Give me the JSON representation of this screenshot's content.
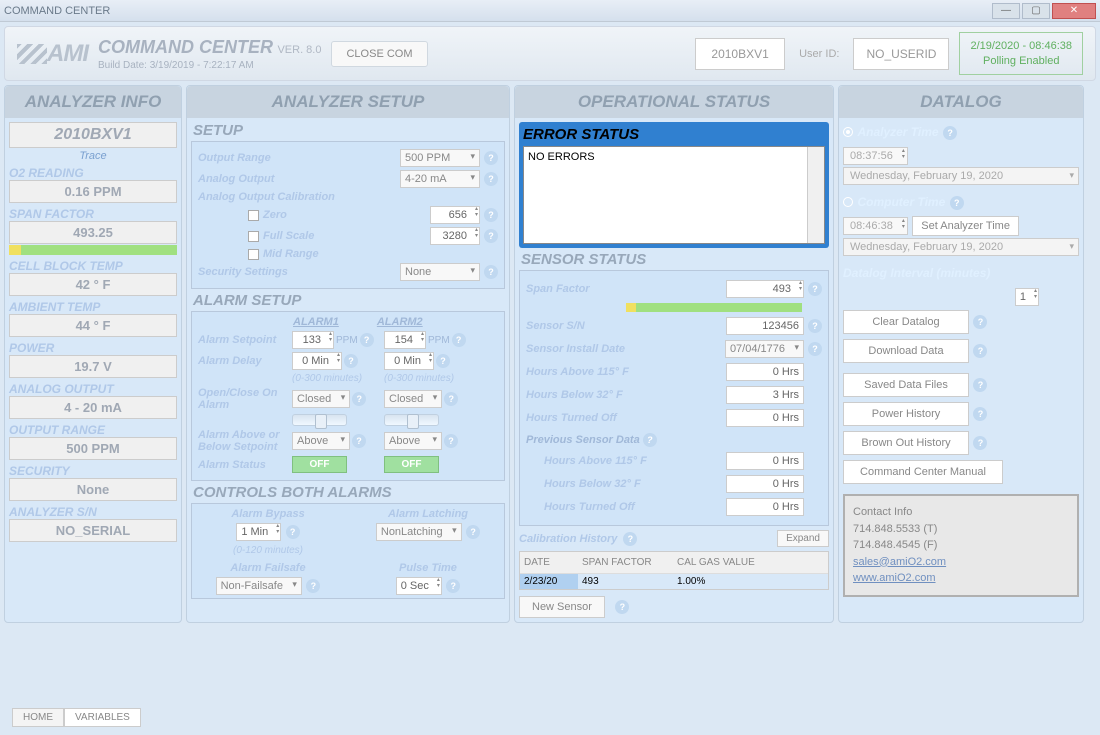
{
  "titlebar": {
    "title": "COMMAND CENTER"
  },
  "header": {
    "app_title": "COMMAND CENTER",
    "version": "VER. 8.0",
    "build_date": "Build Date:  3/19/2019 - 7:22:17 AM",
    "close_com": "CLOSE COM",
    "analyzer_id": "2010BXV1",
    "user_id_label": "User ID:",
    "user_id": "NO_USERID",
    "poll_time": "2/19/2020 - 08:46:38",
    "poll_status": "Polling Enabled"
  },
  "tabs": {
    "analyzer_info": "ANALYZER INFO",
    "analyzer_setup": "ANALYZER SETUP",
    "operational_status": "OPERATIONAL STATUS",
    "datalog": "DATALOG"
  },
  "info": {
    "name": "2010BXV1",
    "sub": "Trace",
    "o2_label": "O2 READING",
    "o2_val": "0.16 PPM",
    "span_label": "SPAN FACTOR",
    "span_val": "493.25",
    "cell_label": "CELL BLOCK TEMP",
    "cell_val": "42 ° F",
    "amb_label": "AMBIENT TEMP",
    "amb_val": "44 ° F",
    "power_label": "POWER",
    "power_val": "19.7 V",
    "analog_label": "ANALOG OUTPUT",
    "analog_val": "4 - 20 mA",
    "range_label": "OUTPUT RANGE",
    "range_val": "500 PPM",
    "sec_label": "SECURITY",
    "sec_val": "None",
    "sn_label": "ANALYZER S/N",
    "sn_val": "NO_SERIAL"
  },
  "setup": {
    "title": "SETUP",
    "output_range_label": "Output Range",
    "output_range": "500 PPM",
    "analog_output_label": "Analog Output",
    "analog_output": "4-20 mA",
    "calib_label": "Analog Output Calibration",
    "zero_label": "Zero",
    "zero_val": "656",
    "full_label": "Full Scale",
    "full_val": "3280",
    "mid_label": "Mid Range",
    "sec_label": "Security Settings",
    "sec_val": "None"
  },
  "alarm": {
    "title": "ALARM SETUP",
    "h1": "ALARM1",
    "h2": "ALARM2",
    "setpoint_label": "Alarm Setpoint",
    "sp1": "133",
    "sp2": "154",
    "ppm": "PPM",
    "delay_label": "Alarm Delay",
    "d1": "0 Min",
    "d2": "0 Min",
    "delay_note": "(0-300 minutes)",
    "oc_label": "Open/Close On Alarm",
    "oc1": "Closed",
    "oc2": "Closed",
    "ab_label": "Alarm Above or Below Setpoint",
    "ab1": "Above",
    "ab2": "Above",
    "status_label": "Alarm Status",
    "off": "OFF"
  },
  "controls": {
    "title": "CONTROLS BOTH ALARMS",
    "bypass_label": "Alarm Bypass",
    "bypass_val": "1 Min",
    "bypass_note": "(0-120 minutes)",
    "latch_label": "Alarm Latching",
    "latch_val": "NonLatching",
    "fail_label": "Alarm Failsafe",
    "fail_val": "Non-Failsafe",
    "pulse_label": "Pulse Time",
    "pulse_val": "0 Sec"
  },
  "op": {
    "error_title": "ERROR STATUS",
    "error_text": "NO ERRORS",
    "sensor_title": "SENSOR STATUS",
    "span_label": "Span Factor",
    "span_val": "493",
    "sn_label": "Sensor S/N",
    "sn_val": "123456",
    "inst_label": "Sensor Install Date",
    "inst_val": "07/04/1776",
    "h115_label": "Hours Above 115° F",
    "h115_val": "0 Hrs",
    "h32_label": "Hours Below 32° F",
    "h32_val": "3 Hrs",
    "hoff_label": "Hours Turned Off",
    "hoff_val": "0 Hrs",
    "prev_label": "Previous Sensor Data",
    "p115": "0 Hrs",
    "p32": "0 Hrs",
    "poff": "0 Hrs",
    "cal_title": "Calibration History",
    "expand": "Expand",
    "th_date": "DATE",
    "th_span": "SPAN FACTOR",
    "th_gas": "CAL GAS VALUE",
    "r_date": "2/23/20",
    "r_span": "493",
    "r_gas": "1.00%",
    "new_sensor": "New Sensor"
  },
  "dl": {
    "an_time_label": "Analyzer Time",
    "an_time": "08:37:56",
    "an_date": "Wednesday,  February   19, 2020",
    "cp_time_label": "Computer Time",
    "cp_time": "08:46:38",
    "cp_date": "Wednesday,  February   19, 2020",
    "set_btn": "Set Analyzer Time",
    "interval_label": "Datalog Interval (minutes)",
    "interval_val": "1",
    "clear": "Clear Datalog",
    "download": "Download Data",
    "saved": "Saved Data Files",
    "power_hist": "Power History",
    "brown": "Brown Out History",
    "manual": "Command Center Manual",
    "contact_title": "Contact Info",
    "phone1": "714.848.5533 (T)",
    "phone2": "714.848.4545 (F)",
    "email": "sales@amiO2.com",
    "web": "www.amiO2.com"
  },
  "bottom": {
    "home": "HOME",
    "vars": "VARIABLES"
  }
}
